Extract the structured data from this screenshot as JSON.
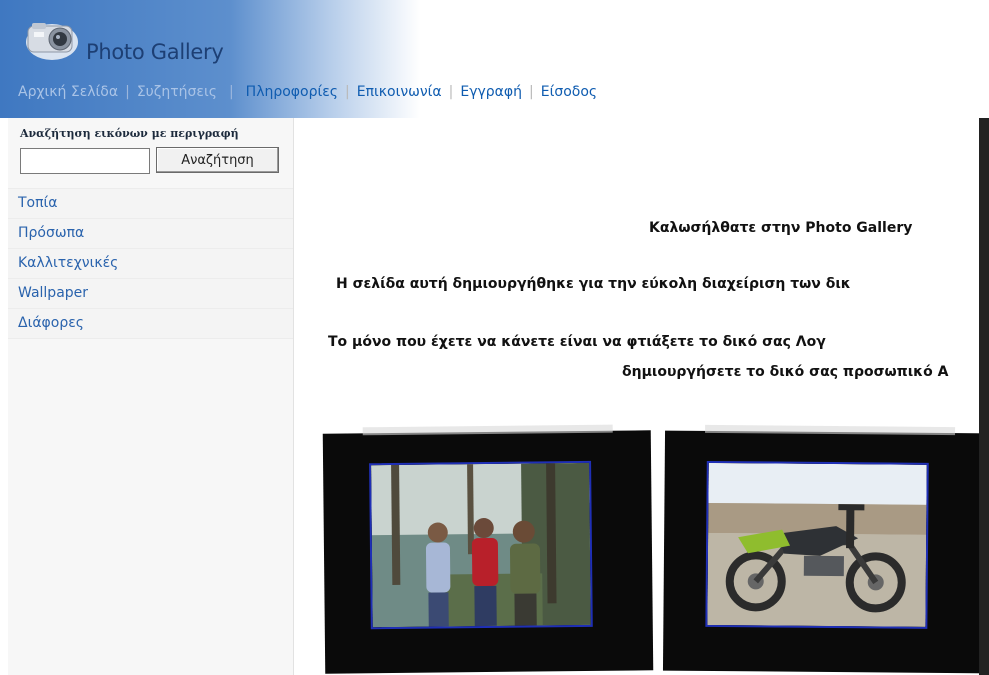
{
  "header": {
    "title": "Photo Gallery",
    "logo_icon": "camera-icon",
    "nav": [
      {
        "label": "Αρχική Σελίδα",
        "style": "dim"
      },
      {
        "label": "Συζητήσεις",
        "style": "dim"
      },
      {
        "label": "Πληροφορίες",
        "style": "active"
      },
      {
        "label": "Επικοινωνία",
        "style": "active"
      },
      {
        "label": "Εγγραφή",
        "style": "active"
      },
      {
        "label": "Είσοδος",
        "style": "active"
      }
    ]
  },
  "sidebar": {
    "search_label": "Αναζήτηση εικόνων με περιγραφή",
    "search_value": "",
    "search_button": "Αναζήτηση",
    "categories": [
      "Τοπία",
      "Πρόσωπα",
      "Καλλιτεχνικές",
      "Wallpaper",
      "Διάφορες"
    ]
  },
  "main": {
    "welcome": "Καλωσήλθατε στην Photo Gallery",
    "line1": "Η σελίδα αυτή δημιουργήθηκε για την εύκολη διαχείριση των δικ",
    "line2": "Το μόνο που έχετε να κάνετε είναι να φτιάξετε το δικό σας Λογ",
    "line3": "δημιουργήσετε το δικό σας προσωπικό Α"
  },
  "colors": {
    "header_blue": "#3f78c1",
    "nav_active": "#0f5cb0",
    "category_text": "#2a63ad",
    "photo_border": "#1f2fb6"
  }
}
